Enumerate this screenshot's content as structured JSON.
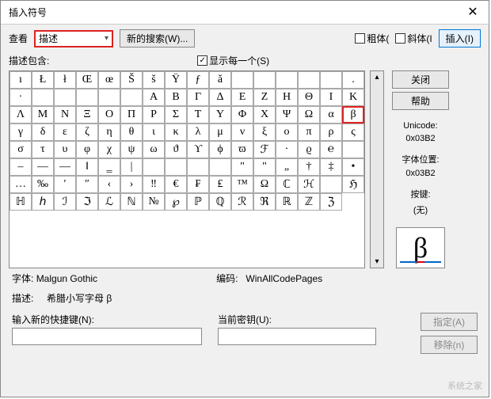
{
  "title": "插入符号",
  "view_label": "查看",
  "dropdown_value": "描述",
  "new_search": "新的搜索(W)...",
  "bold_label": "粗体(",
  "italic_label": "斜体(I",
  "insert_btn": "插入(I)",
  "desc_contain": "描述包含:",
  "show_each": "显示每一个(S)",
  "close_btn": "关闭",
  "help_btn": "帮助",
  "unicode_label": "Unicode:",
  "unicode_value": "0x03B2",
  "fontpos_label": "字体位置:",
  "fontpos_value": "0x03B2",
  "keypress_label": "按键:",
  "keypress_value": "(无)",
  "preview_char": "β",
  "font_label": "字体:",
  "font_value": "Malgun Gothic",
  "encoding_label": "编码:",
  "encoding_value": "WinAllCodePages",
  "desc_label": "描述:",
  "desc_value": "希腊小写字母 β",
  "shortcut_label": "输入新的快捷键(N):",
  "current_key_label": "当前密钥(U):",
  "assign_btn": "指定(A)",
  "remove_btn": "移除(n)",
  "watermark": "系统之家",
  "grid": [
    [
      "ı",
      "Ł",
      "ł",
      "Œ",
      "œ",
      "Š",
      "š",
      "Ÿ",
      "ƒ",
      "ǎ",
      "",
      "",
      "",
      "",
      "",
      "."
    ],
    [
      "·",
      "",
      "",
      "",
      "",
      "",
      "Α",
      "Β",
      "Γ",
      "Δ",
      "Ε",
      "Ζ",
      "Η",
      "Θ",
      "Ι",
      "Κ"
    ],
    [
      "Λ",
      "Μ",
      "Ν",
      "Ξ",
      "Ο",
      "Π",
      "Ρ",
      "Σ",
      "Τ",
      "Υ",
      "Φ",
      "Χ",
      "Ψ",
      "Ω",
      "α",
      "β"
    ],
    [
      "γ",
      "δ",
      "ε",
      "ζ",
      "η",
      "θ",
      "ι",
      "κ",
      "λ",
      "μ",
      "ν",
      "ξ",
      "ο",
      "π",
      "ρ",
      "ς"
    ],
    [
      "σ",
      "τ",
      "υ",
      "φ",
      "χ",
      "ψ",
      "ω",
      "ϑ",
      "ϒ",
      "ϕ",
      "ϖ",
      "ℱ",
      "∙",
      "ϱ",
      "℮",
      ""
    ],
    [
      "–",
      "—",
      "―",
      "‖",
      "‗",
      "|",
      "",
      "",
      "",
      "",
      "\"",
      "\"",
      "„",
      "†",
      "‡",
      "•"
    ],
    [
      "…",
      "‰",
      "′",
      "″",
      "‹",
      "›",
      "‼",
      "€",
      "₣",
      "₤",
      "™",
      "Ω",
      "ℂ",
      "ℋ",
      ""
    ],
    [
      "ℌ",
      "ℍ",
      "ℎ",
      "ℐ",
      "ℑ",
      "ℒ",
      "ℕ",
      "№",
      "℘",
      "ℙ",
      "ℚ",
      "ℛ",
      "ℜ",
      "ℝ",
      "ℤ",
      "ℨ"
    ]
  ],
  "selected": {
    "row": 2,
    "col": 15
  }
}
